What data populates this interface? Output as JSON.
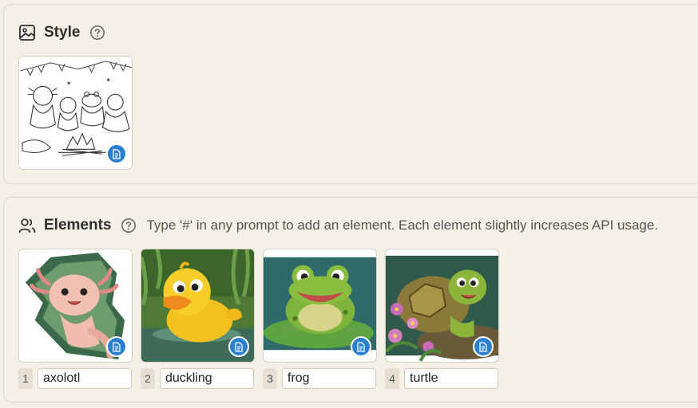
{
  "style_section": {
    "title": "Style",
    "help_icon": "question-circle-icon",
    "header_icon": "image-icon",
    "image": {
      "description_icon": "document-icon"
    }
  },
  "elements_section": {
    "title": "Elements",
    "help_icon": "question-circle-icon",
    "header_icon": "users-icon",
    "hint": "Type '#' in any prompt to add an element. Each element slightly increases API usage.",
    "items": [
      {
        "index": "1",
        "name": "axolotl"
      },
      {
        "index": "2",
        "name": "duckling"
      },
      {
        "index": "3",
        "name": "frog"
      },
      {
        "index": "4",
        "name": "turtle"
      }
    ]
  },
  "colors": {
    "background": "#f3efe5",
    "badge": "#2b7fd0"
  }
}
